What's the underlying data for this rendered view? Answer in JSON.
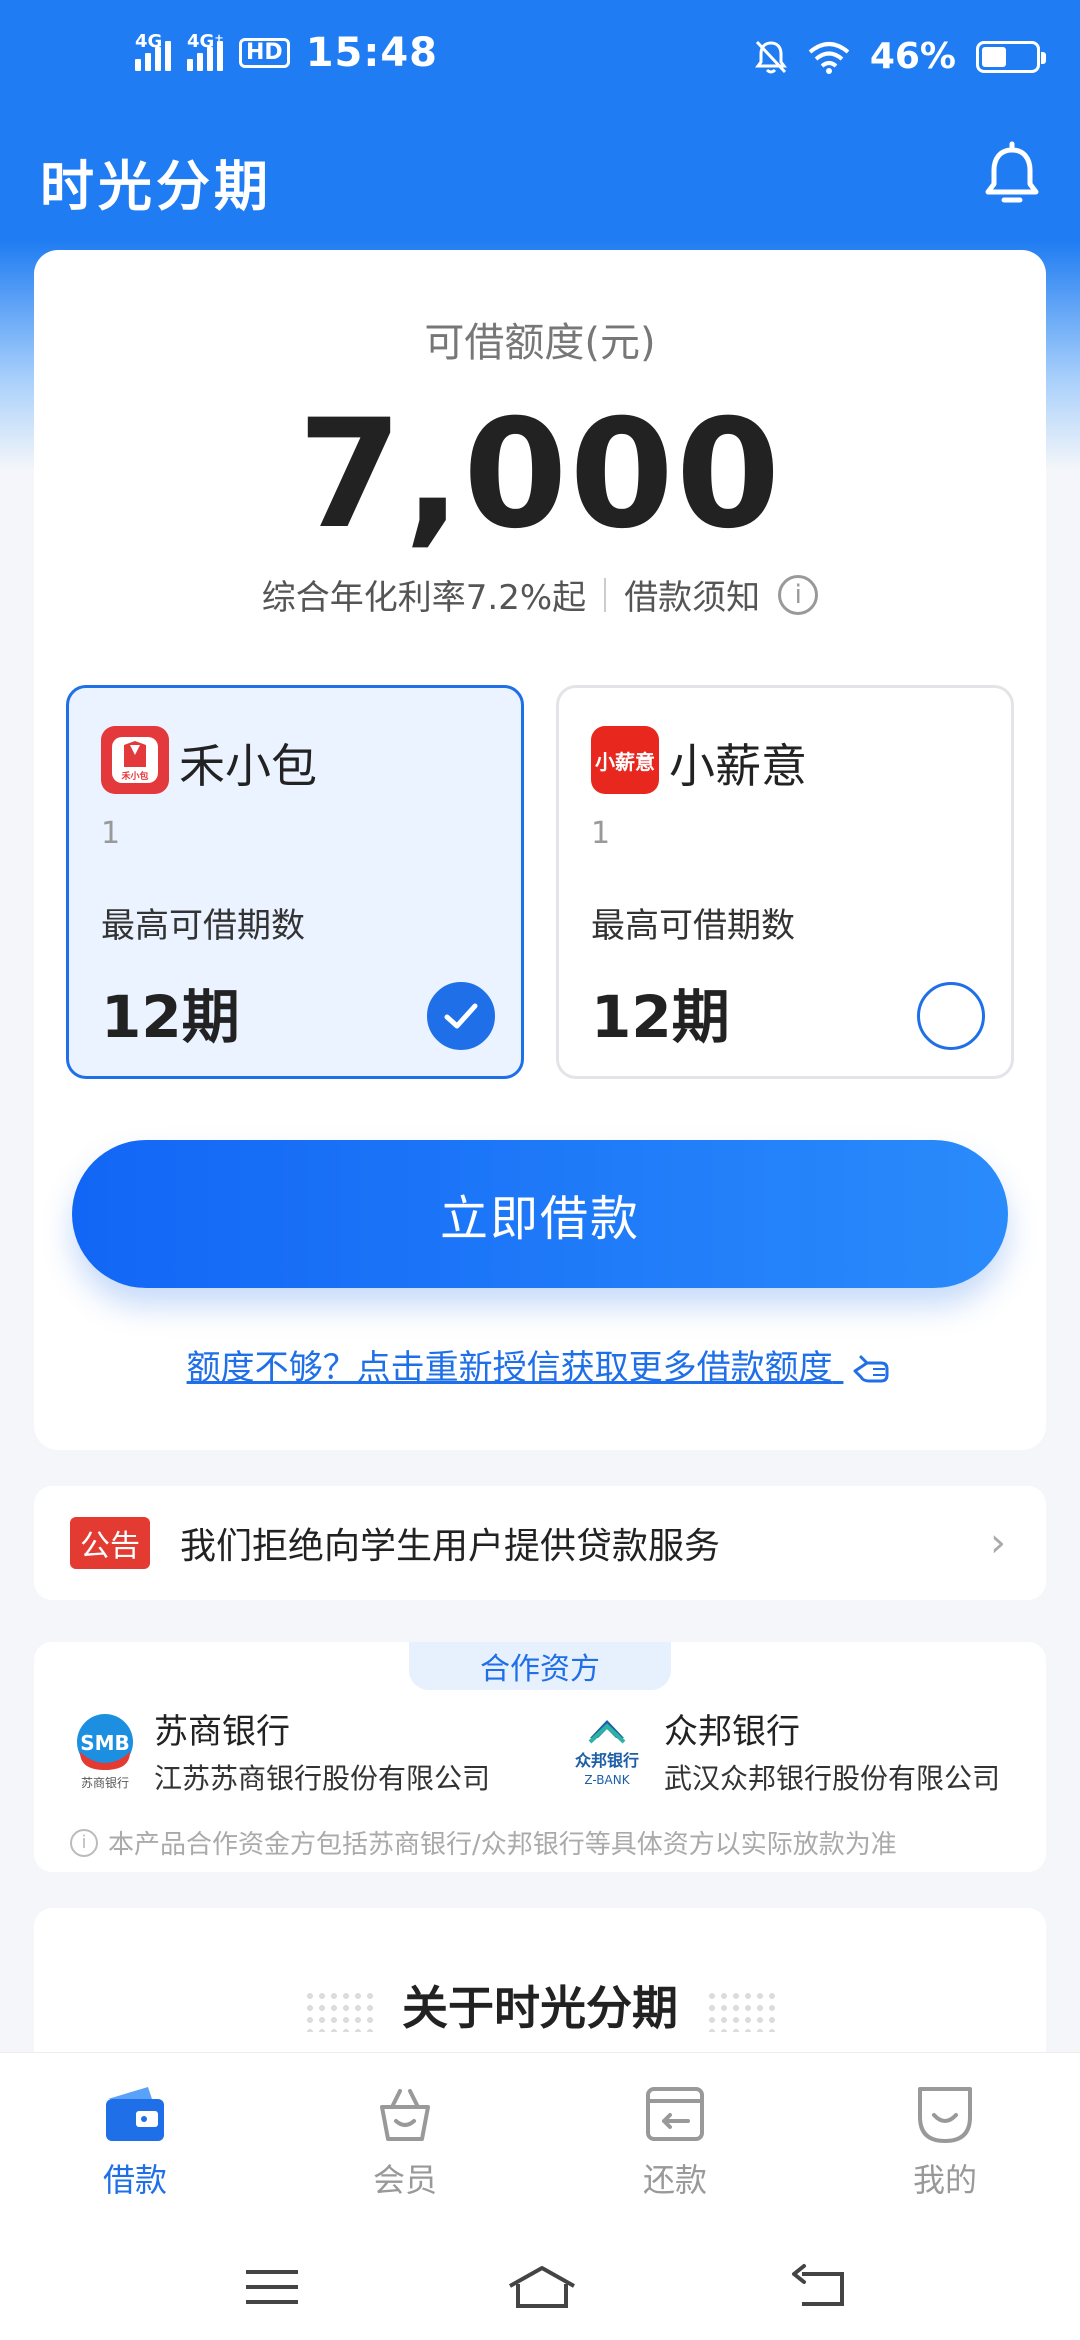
{
  "status_bar": {
    "network_1": "4G",
    "network_2": "4G⁺",
    "hd": "HD",
    "time": "15:48",
    "battery": "46%",
    "battery_level": 0.46
  },
  "header": {
    "title": "时光分期",
    "bell_icon": "bell-icon"
  },
  "quota": {
    "label": "可借额度(元)",
    "amount": "7,000",
    "rate": "综合年化利率7.2%起",
    "notice_link": "借款须知",
    "info_icon": "i"
  },
  "products": [
    {
      "logo_text": "禾小包",
      "name": "禾小包",
      "number": "1",
      "label": "最高可借期数",
      "term": "12期",
      "selected": true,
      "logo_color": "#e4393c"
    },
    {
      "logo_text": "小薪意",
      "name": "小薪意",
      "number": "1",
      "label": "最高可借期数",
      "term": "12期",
      "selected": false,
      "logo_color": "#e8281f"
    }
  ],
  "borrow_button": "立即借款",
  "relink": "额度不够？点击重新授信获取更多借款额度",
  "notice": {
    "badge": "公告",
    "text": "我们拒绝向学生用户提供贷款服务",
    "chevron": "›"
  },
  "partners": {
    "title": "合作资方",
    "banks": [
      {
        "logo": "SMB",
        "logo_sub": "苏商银行",
        "name": "苏商银行",
        "full": "江苏苏商银行股份有限公司"
      },
      {
        "logo": "众邦银行",
        "logo_sub": "Z-BANK",
        "name": "众邦银行",
        "full": "武汉众邦银行股份有限公司"
      }
    ],
    "disclaimer": "本产品合作资金方包括苏商银行/众邦银行等具体资方以实际放款为准"
  },
  "about": {
    "title": "关于时光分期"
  },
  "nav": {
    "items": [
      {
        "label": "借款",
        "icon": "wallet-icon",
        "active": true
      },
      {
        "label": "会员",
        "icon": "basket-icon",
        "active": false
      },
      {
        "label": "还款",
        "icon": "card-return-icon",
        "active": false
      },
      {
        "label": "我的",
        "icon": "smile-face-icon",
        "active": false
      }
    ]
  },
  "colors": {
    "brand": "#1f7cf2",
    "accent": "#1f6fe8",
    "notice_red": "#e33b32"
  }
}
